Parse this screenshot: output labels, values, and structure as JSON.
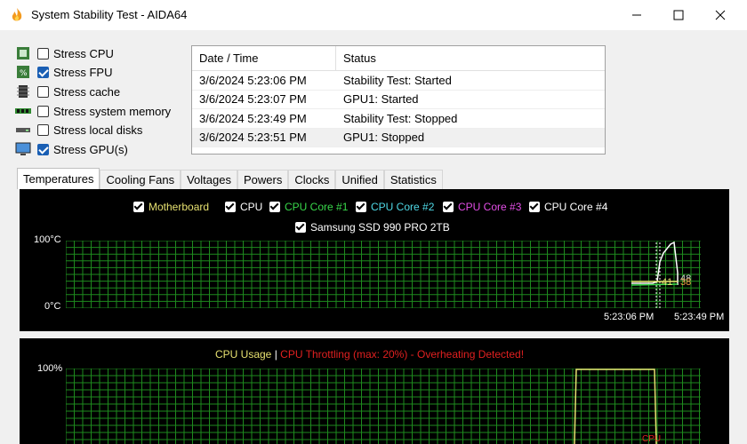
{
  "window": {
    "title": "System Stability Test - AIDA64",
    "minimize_glyph": "—",
    "maximize_glyph": "☐",
    "close_glyph": "✕"
  },
  "stress_options": [
    {
      "label": "Stress CPU",
      "checked": false,
      "icon": "cpu-chip-icon"
    },
    {
      "label": "Stress FPU",
      "checked": true,
      "icon": "fpu-chip-icon"
    },
    {
      "label": "Stress cache",
      "checked": false,
      "icon": "cache-icon"
    },
    {
      "label": "Stress system memory",
      "checked": false,
      "icon": "memory-module-icon"
    },
    {
      "label": "Stress local disks",
      "checked": false,
      "icon": "disk-icon"
    },
    {
      "label": "Stress GPU(s)",
      "checked": true,
      "icon": "monitor-icon"
    }
  ],
  "log": {
    "headers": {
      "date": "Date / Time",
      "status": "Status"
    },
    "rows": [
      {
        "date": "3/6/2024 5:23:06 PM",
        "status": "Stability Test: Started"
      },
      {
        "date": "3/6/2024 5:23:07 PM",
        "status": "GPU1: Started"
      },
      {
        "date": "3/6/2024 5:23:49 PM",
        "status": "Stability Test: Stopped"
      },
      {
        "date": "3/6/2024 5:23:51 PM",
        "status": "GPU1: Stopped"
      }
    ]
  },
  "tabs": [
    "Temperatures",
    "Cooling Fans",
    "Voltages",
    "Powers",
    "Clocks",
    "Unified",
    "Statistics"
  ],
  "active_tab": "Temperatures",
  "temp_graph": {
    "legend": [
      {
        "label": "Motherboard",
        "color": "#e6e070"
      },
      {
        "label": "CPU",
        "color": "#ffffff"
      },
      {
        "label": "CPU Core #1",
        "color": "#39d94b"
      },
      {
        "label": "CPU Core #2",
        "color": "#4fd9e6"
      },
      {
        "label": "CPU Core #3",
        "color": "#e34ee6"
      },
      {
        "label": "CPU Core #4",
        "color": "#ffffff"
      },
      {
        "label": "Samsung SSD 990 PRO 2TB",
        "color": "#ffffff"
      }
    ],
    "y_max_label": "100°C",
    "y_min_label": "0°C",
    "time_labels": [
      "5:23:06 PM",
      "5:23:49 PM"
    ],
    "readout_41": "41",
    "readout_38": "38",
    "readout_48": "48",
    "grid_color": "#1e8a1e"
  },
  "usage_graph": {
    "title_usage": "CPU Usage",
    "separator": "|",
    "title_throttle": "CPU Throttling (max: 20%) - Overheating Detected!",
    "usage_color": "#e6e070",
    "throttle_color": "#e02020",
    "y_max_label": "100%",
    "throttle_value_label": "CPU"
  }
}
